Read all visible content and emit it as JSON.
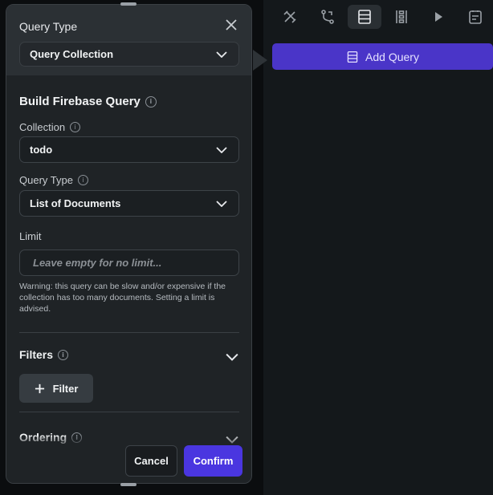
{
  "toolbar": {
    "items": [
      {
        "icon": "tools-icon",
        "active": false
      },
      {
        "icon": "branch-icon",
        "active": false
      },
      {
        "icon": "database-icon",
        "active": true
      },
      {
        "icon": "layout-list-icon",
        "active": false
      },
      {
        "icon": "play-icon",
        "active": false
      },
      {
        "icon": "note-icon",
        "active": false
      }
    ]
  },
  "add_query": {
    "label": "Add Query",
    "icon": "database-icon",
    "color": "#4a35c8"
  },
  "panel": {
    "query_type_header": {
      "label": "Query Type",
      "value": "Query Collection",
      "close_icon": "close-icon"
    },
    "title": "Build Firebase Query",
    "collection": {
      "label": "Collection",
      "value": "todo"
    },
    "query_type": {
      "label": "Query Type",
      "value": "List of Documents"
    },
    "limit": {
      "label": "Limit",
      "placeholder": "Leave empty for no limit...",
      "value": ""
    },
    "warning": "Warning: this query can be slow and/or expensive if the collection has too many documents. Setting a limit is advised.",
    "filters": {
      "label": "Filters",
      "button_label": "Filter",
      "button_icon": "plus-icon"
    },
    "ordering": {
      "label": "Ordering"
    },
    "buttons": {
      "cancel": "Cancel",
      "confirm": "Confirm",
      "confirm_color": "#4a36e0"
    }
  }
}
